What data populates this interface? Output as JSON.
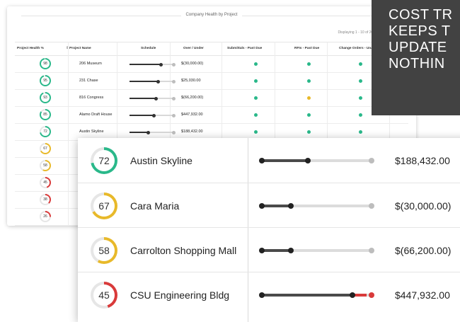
{
  "back_table": {
    "title": "Company Health by Project",
    "paging": "Displaying 1 - 10 of 203",
    "page_label": "Pa",
    "columns": [
      "Project Health %",
      "Project Name",
      "Schedule",
      "Over / Under",
      "Submittals - Past Due",
      "RFIs - Past Due",
      "Change Orders - Unapprove"
    ],
    "rows": [
      {
        "health": "98",
        "name": "206 Museum",
        "fill": 0.72,
        "money": "$(30,000.00)",
        "c1": "#2ab88a",
        "c2": "#2ab88a",
        "c3": "#2ab88a"
      },
      {
        "health": "95",
        "name": "231 Chase",
        "fill": 0.66,
        "money": "$25,030.00",
        "c1": "#2ab88a",
        "c2": "#2ab88a",
        "c3": "#2ab88a"
      },
      {
        "health": "93",
        "name": "816 Congress",
        "fill": 0.6,
        "money": "$(66,200.00)",
        "c1": "#2ab88a",
        "c2": "#e8b92a",
        "c3": "#2ab88a"
      },
      {
        "health": "85",
        "name": "Alamo Draft House",
        "fill": 0.55,
        "money": "$447,932.00",
        "c1": "#2ab88a",
        "c2": "#2ab88a",
        "c3": "#2ab88a"
      },
      {
        "health": "72",
        "name": "Austin Skyline",
        "fill": 0.42,
        "money": "$188,432.00",
        "c1": "#2ab88a",
        "c2": "#2ab88a",
        "c3": "#2ab88a"
      },
      {
        "health": "67",
        "name": "Car",
        "fill": 0.3,
        "money": "",
        "c1": "",
        "c2": "",
        "c3": ""
      },
      {
        "health": "58",
        "name": "Carr",
        "fill": 0.3,
        "money": "",
        "c1": "",
        "c2": "",
        "c3": ""
      },
      {
        "health": "45",
        "name": "CSU",
        "fill": 0.3,
        "money": "",
        "c1": "",
        "c2": "",
        "c3": ""
      },
      {
        "health": "38",
        "name": "CSU",
        "fill": 0.3,
        "money": "",
        "c1": "",
        "c2": "",
        "c3": ""
      },
      {
        "health": "26",
        "name": "Dog",
        "fill": 0.3,
        "money": "",
        "c1": "",
        "c2": "",
        "c3": ""
      }
    ]
  },
  "zoom_rows": [
    {
      "health": "72",
      "pct": 0.72,
      "color": "#2ab88a",
      "name": "Austin Skyline",
      "fill": 0.42,
      "red": 0,
      "money": "$188,432.00"
    },
    {
      "health": "67",
      "pct": 0.67,
      "color": "#e8b92a",
      "name": "Cara Maria",
      "fill": 0.27,
      "red": 0,
      "money": "$(30,000.00)"
    },
    {
      "health": "58",
      "pct": 0.58,
      "color": "#e8b92a",
      "name": "Carrolton Shopping Mall",
      "fill": 0.27,
      "red": 0,
      "money": "$(66,200.00)"
    },
    {
      "health": "45",
      "pct": 0.45,
      "color": "#d93a3a",
      "name": "CSU Engineering Bldg",
      "fill": 0.82,
      "red": 0.13,
      "money": "$447,932.00"
    }
  ],
  "overlay": {
    "lines": [
      "COST TR",
      "KEEPS T",
      "UPDATE",
      "NOTHIN"
    ]
  },
  "colors": {
    "green": "#2ab88a",
    "yellow": "#e8b92a",
    "red": "#d93a3a",
    "overlay_bg": "#424242"
  }
}
